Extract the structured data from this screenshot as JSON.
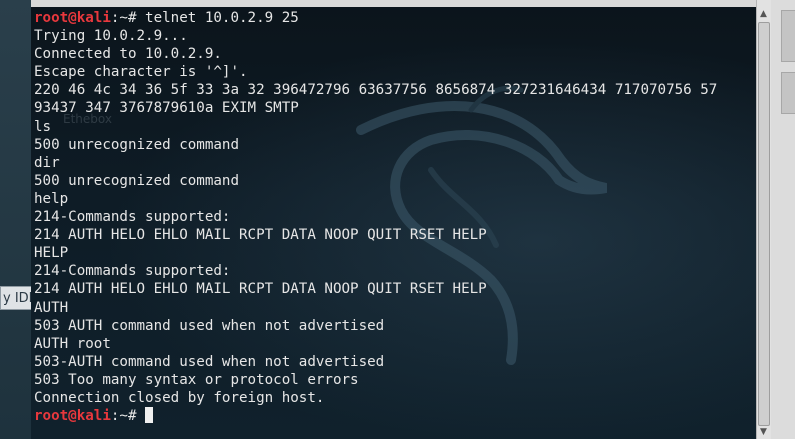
{
  "sidebar": {
    "ide_label": "y IDE"
  },
  "terminal": {
    "prompt_user": "root@kali",
    "prompt_path": ":~# ",
    "command": "telnet 10.0.2.9 25",
    "ghost_text": "Ethebox",
    "lines": [
      "Trying 10.0.2.9...",
      "Connected to 10.0.2.9.",
      "Escape character is '^]'.",
      "220 46 4c 34 36 5f 33 3a 32 396472796 63637756 8656874 327231646434 717070756 57",
      "93437 347 3767879610a EXIM SMTP",
      "ls",
      "500 unrecognized command",
      "dir",
      "500 unrecognized command",
      "help",
      "214-Commands supported:",
      "214 AUTH HELO EHLO MAIL RCPT DATA NOOP QUIT RSET HELP",
      "HELP",
      "214-Commands supported:",
      "214 AUTH HELO EHLO MAIL RCPT DATA NOOP QUIT RSET HELP",
      "AUTH",
      "503 AUTH command used when not advertised",
      "AUTH root",
      "503-AUTH command used when not advertised",
      "503 Too many syntax or protocol errors",
      "Connection closed by foreign host."
    ],
    "colors": {
      "prompt_user": "#e8383d",
      "text": "#e6e6e6",
      "background": "#0e1c26"
    }
  },
  "scrollbar": {
    "up_icon": "▲",
    "down_icon": "▼"
  }
}
